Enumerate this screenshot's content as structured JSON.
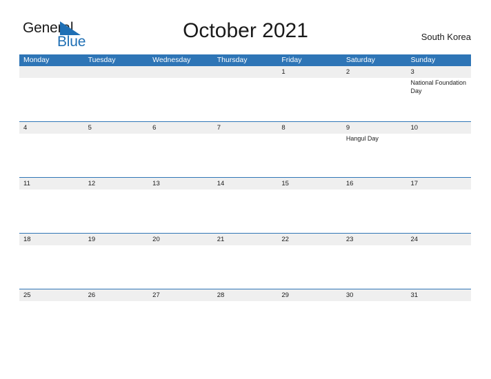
{
  "logo": {
    "word_one": "General",
    "word_two": "Blue",
    "flag_icon": "blue-flag-triangle-icon",
    "blue": "#1F6FB4"
  },
  "header": {
    "title": "October 2021",
    "country": "South Korea"
  },
  "colors": {
    "header_blue": "#2E75B6",
    "row_band_gray": "#EFEFEF",
    "page_background": "#FFFFFF",
    "text": "#1A1A1A"
  },
  "calendar": {
    "month": "October",
    "year": "2021",
    "weekday_headers": [
      "Monday",
      "Tuesday",
      "Wednesday",
      "Thursday",
      "Friday",
      "Saturday",
      "Sunday"
    ],
    "weeks": [
      [
        {
          "day": "",
          "events": []
        },
        {
          "day": "",
          "events": []
        },
        {
          "day": "",
          "events": []
        },
        {
          "day": "",
          "events": []
        },
        {
          "day": "1",
          "events": []
        },
        {
          "day": "2",
          "events": []
        },
        {
          "day": "3",
          "events": [
            "National Foundation Day"
          ]
        }
      ],
      [
        {
          "day": "4",
          "events": []
        },
        {
          "day": "5",
          "events": []
        },
        {
          "day": "6",
          "events": []
        },
        {
          "day": "7",
          "events": []
        },
        {
          "day": "8",
          "events": []
        },
        {
          "day": "9",
          "events": [
            "Hangul Day"
          ]
        },
        {
          "day": "10",
          "events": []
        }
      ],
      [
        {
          "day": "11",
          "events": []
        },
        {
          "day": "12",
          "events": []
        },
        {
          "day": "13",
          "events": []
        },
        {
          "day": "14",
          "events": []
        },
        {
          "day": "15",
          "events": []
        },
        {
          "day": "16",
          "events": []
        },
        {
          "day": "17",
          "events": []
        }
      ],
      [
        {
          "day": "18",
          "events": []
        },
        {
          "day": "19",
          "events": []
        },
        {
          "day": "20",
          "events": []
        },
        {
          "day": "21",
          "events": []
        },
        {
          "day": "22",
          "events": []
        },
        {
          "day": "23",
          "events": []
        },
        {
          "day": "24",
          "events": []
        }
      ],
      [
        {
          "day": "25",
          "events": []
        },
        {
          "day": "26",
          "events": []
        },
        {
          "day": "27",
          "events": []
        },
        {
          "day": "28",
          "events": []
        },
        {
          "day": "29",
          "events": []
        },
        {
          "day": "30",
          "events": []
        },
        {
          "day": "31",
          "events": []
        }
      ]
    ]
  }
}
